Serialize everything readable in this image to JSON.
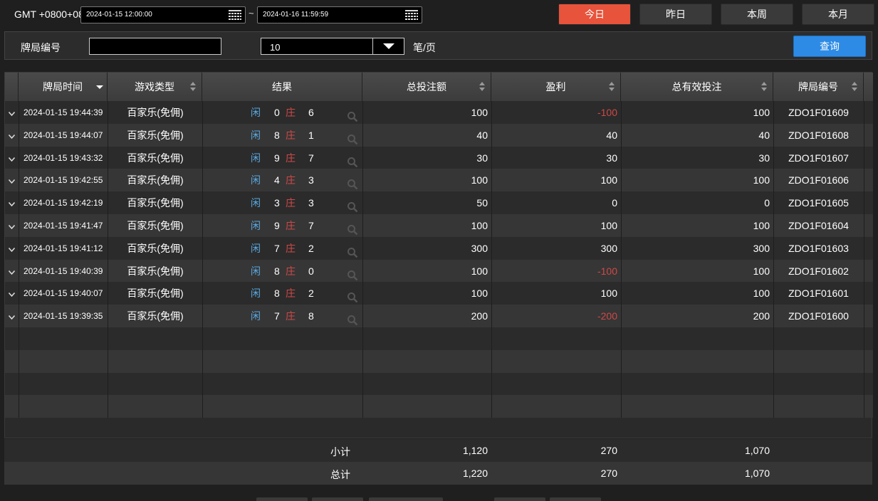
{
  "header": {
    "timezone": "GMT +0800+08",
    "start_date": "2024-01-15 12:00:00",
    "separator": "~",
    "end_date": "2024-01-16 11:59:59",
    "quick_buttons": [
      "今日",
      "昨日",
      "本周",
      "本月"
    ],
    "active_button": "今日"
  },
  "filter": {
    "label": "牌局编号",
    "input_value": "",
    "page_size": "10",
    "page_size_unit": "笔/页",
    "search_label": "查询"
  },
  "table": {
    "columns": [
      "牌局时间",
      "游戏类型",
      "结果",
      "总投注额",
      "盈利",
      "总有效投注",
      "牌局编号"
    ],
    "player_label": "闲",
    "banker_label": "庄",
    "rows": [
      {
        "time": "2024-01-15 19:44:39",
        "game": "百家乐(免佣)",
        "player": "0",
        "banker": "6",
        "bet": "100",
        "profit": "-100",
        "valid": "100",
        "id": "ZDO1F01609"
      },
      {
        "time": "2024-01-15 19:44:07",
        "game": "百家乐(免佣)",
        "player": "8",
        "banker": "1",
        "bet": "40",
        "profit": "40",
        "valid": "40",
        "id": "ZDO1F01608"
      },
      {
        "time": "2024-01-15 19:43:32",
        "game": "百家乐(免佣)",
        "player": "9",
        "banker": "7",
        "bet": "30",
        "profit": "30",
        "valid": "30",
        "id": "ZDO1F01607"
      },
      {
        "time": "2024-01-15 19:42:55",
        "game": "百家乐(免佣)",
        "player": "4",
        "banker": "3",
        "bet": "100",
        "profit": "100",
        "valid": "100",
        "id": "ZDO1F01606"
      },
      {
        "time": "2024-01-15 19:42:19",
        "game": "百家乐(免佣)",
        "player": "3",
        "banker": "3",
        "bet": "50",
        "profit": "0",
        "valid": "0",
        "id": "ZDO1F01605"
      },
      {
        "time": "2024-01-15 19:41:47",
        "game": "百家乐(免佣)",
        "player": "9",
        "banker": "7",
        "bet": "100",
        "profit": "100",
        "valid": "100",
        "id": "ZDO1F01604"
      },
      {
        "time": "2024-01-15 19:41:12",
        "game": "百家乐(免佣)",
        "player": "7",
        "banker": "2",
        "bet": "300",
        "profit": "300",
        "valid": "300",
        "id": "ZDO1F01603"
      },
      {
        "time": "2024-01-15 19:40:39",
        "game": "百家乐(免佣)",
        "player": "8",
        "banker": "0",
        "bet": "100",
        "profit": "-100",
        "valid": "100",
        "id": "ZDO1F01602"
      },
      {
        "time": "2024-01-15 19:40:07",
        "game": "百家乐(免佣)",
        "player": "8",
        "banker": "2",
        "bet": "100",
        "profit": "100",
        "valid": "100",
        "id": "ZDO1F01601"
      },
      {
        "time": "2024-01-15 19:39:35",
        "game": "百家乐(免佣)",
        "player": "7",
        "banker": "8",
        "bet": "200",
        "profit": "-200",
        "valid": "200",
        "id": "ZDO1F01600"
      }
    ]
  },
  "subtotal": {
    "label": "小计",
    "bet": "1,120",
    "profit": "270",
    "valid": "1,070"
  },
  "total": {
    "label": "总计",
    "bet": "1,220",
    "profit": "270",
    "valid": "1,070"
  },
  "colors": {
    "accent_today": "#e8533b",
    "search": "#2d8be6",
    "player": "#5aa8e0",
    "banker_negative": "#d04848"
  }
}
